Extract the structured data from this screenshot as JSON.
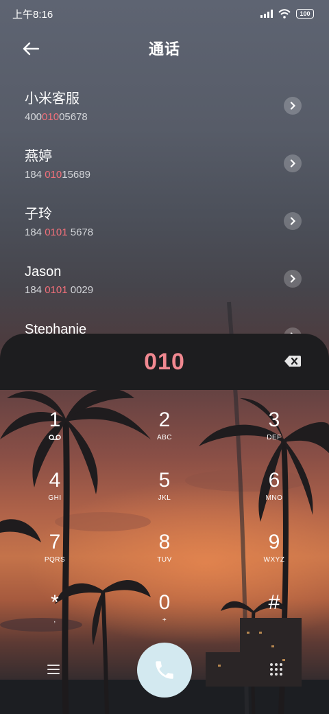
{
  "status_bar": {
    "time": "上午8:16",
    "battery": "100"
  },
  "header": {
    "title": "通话"
  },
  "contacts": [
    {
      "name": "小米客服",
      "number_pre": "400",
      "number_match": "010",
      "number_post": "05678"
    },
    {
      "name": "燕婷",
      "number_pre": "184 ",
      "number_match": "010",
      "number_post": "15689"
    },
    {
      "name": "子玲",
      "number_pre": "184 ",
      "number_match": "0101",
      "number_post": " 5678"
    },
    {
      "name": "Jason",
      "number_pre": "184 ",
      "number_match": "0101",
      "number_post": " 0029"
    },
    {
      "name": "Stephanie",
      "number_pre": "",
      "number_match": "",
      "number_post": ""
    }
  ],
  "dialer": {
    "dialed_number": "010",
    "keys": [
      {
        "digit": "1",
        "letters": ""
      },
      {
        "digit": "2",
        "letters": "ABC"
      },
      {
        "digit": "3",
        "letters": "DEF"
      },
      {
        "digit": "4",
        "letters": "GHI"
      },
      {
        "digit": "5",
        "letters": "JKL"
      },
      {
        "digit": "6",
        "letters": "MNO"
      },
      {
        "digit": "7",
        "letters": "PQRS"
      },
      {
        "digit": "8",
        "letters": "TUV"
      },
      {
        "digit": "9",
        "letters": "WXYZ"
      },
      {
        "digit": "*",
        "letters": ","
      },
      {
        "digit": "0",
        "letters": "+"
      },
      {
        "digit": "#",
        "letters": ""
      }
    ]
  },
  "icons": {
    "back": "arrow-left-icon",
    "chevron": "chevron-right-icon",
    "delete": "backspace-icon",
    "voicemail": "voicemail-icon",
    "menu": "menu-icon",
    "call": "phone-icon",
    "dialpad": "dialpad-icon"
  },
  "colors": {
    "highlight": "#f2707a",
    "dialed": "#f08890",
    "call_button": "#d3e9f0",
    "dial_panel": "#1d1d1f"
  }
}
